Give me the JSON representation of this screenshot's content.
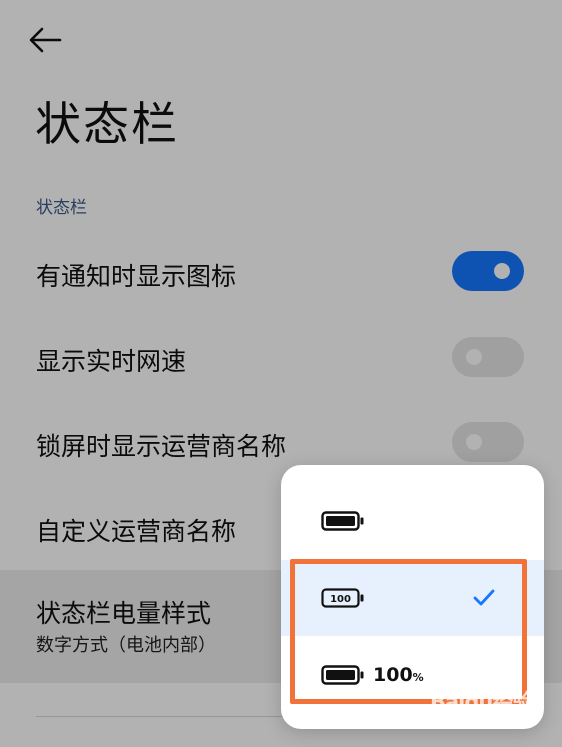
{
  "header": {
    "title": "状态栏"
  },
  "section": {
    "header": "状态栏"
  },
  "settings": {
    "show_icon_on_notify": {
      "label": "有通知时显示图标",
      "enabled": true
    },
    "show_network_speed": {
      "label": "显示实时网速",
      "enabled": false
    },
    "show_carrier_on_lock": {
      "label": "锁屏时显示运营商名称",
      "enabled": false
    },
    "custom_carrier": {
      "label": "自定义运营商名称"
    },
    "battery_style": {
      "label": "状态栏电量样式",
      "value": "数字方式（电池内部）"
    }
  },
  "battery_menu": {
    "options": [
      {
        "id": "icon-only",
        "icon": "battery-icon",
        "text": ""
      },
      {
        "id": "number-inside",
        "icon": "battery-number-icon",
        "icon_text": "100",
        "selected": true
      },
      {
        "id": "icon-with-percent",
        "icon": "battery-icon",
        "text_number": "100",
        "text_unit": "%"
      }
    ]
  },
  "watermark": {
    "logo": "Baidu经验",
    "sub": "jingyan.baidu.com"
  },
  "colors": {
    "accent": "#1677ff",
    "highlight": "#f2733a",
    "section_header": "#3d5a8a"
  }
}
